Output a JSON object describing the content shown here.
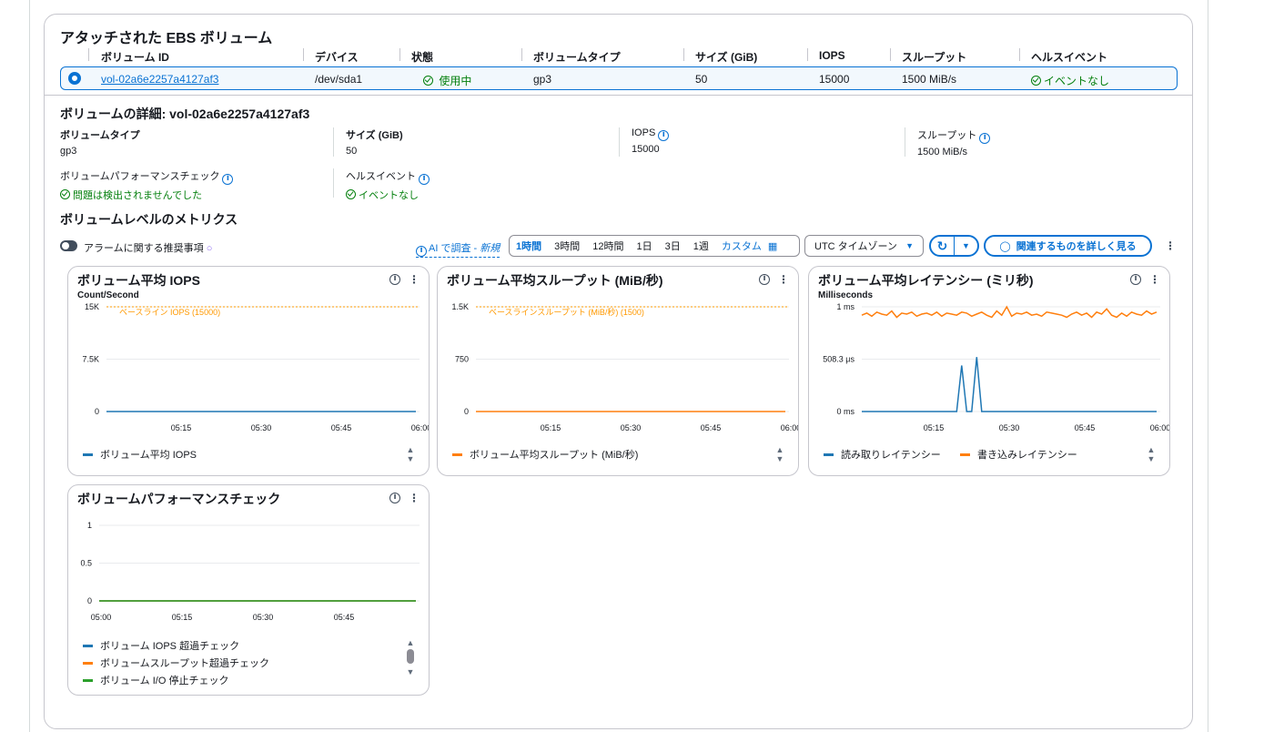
{
  "attached": {
    "title": "アタッチされた EBS ボリューム",
    "columns": [
      "ボリューム ID",
      "デバイス",
      "状態",
      "ボリュームタイプ",
      "サイズ (GiB)",
      "IOPS",
      "スループット",
      "ヘルスイベント"
    ],
    "row": {
      "volume_id": "vol-02a6e2257a4127af3",
      "device": "/dev/sda1",
      "state": "使用中",
      "type": "gp3",
      "size": "50",
      "iops": "15000",
      "throughput": "1500 MiB/s",
      "health": "イベントなし"
    }
  },
  "details": {
    "title": "ボリュームの詳細: vol-02a6e2257a4127af3",
    "type_label": "ボリュームタイプ",
    "type_value": "gp3",
    "size_label": "サイズ (GiB)",
    "size_value": "50",
    "iops_label": "IOPS",
    "iops_value": "15000",
    "throughput_label": "スループット",
    "throughput_value": "1500 MiB/s",
    "perf_label": "ボリュームパフォーマンスチェック",
    "perf_value": "問題は検出されませんでした",
    "health_label": "ヘルスイベント",
    "health_value": "イベントなし"
  },
  "metrics": {
    "title": "ボリュームレベルのメトリクス",
    "alarm_toggle": "アラームに関する推奨事項",
    "ai_label": "AI で調査 - ",
    "ai_new": "新規",
    "ranges": [
      "1時間",
      "3時間",
      "12時間",
      "1日",
      "3日",
      "1週",
      "カスタム"
    ],
    "active_range": "1時間",
    "timezone": "UTC タイムゾーン",
    "explore_button": "関連するものを詳しく見る"
  },
  "chart_data": [
    {
      "type": "line",
      "title": "ボリューム平均 IOPS",
      "ylabel": "Count/Second",
      "yticks": [
        "15K",
        "7.5K",
        "0"
      ],
      "ylim": [
        0,
        15000
      ],
      "x": [
        "05:15",
        "05:30",
        "05:45",
        "06:00"
      ],
      "series": [
        {
          "name": "ボリューム平均 IOPS",
          "values": [
            0,
            0,
            0,
            0,
            0
          ],
          "color": "#1f77b4"
        }
      ],
      "baseline": {
        "label": "ベースライン IOPS (15000)",
        "value": 15000,
        "color": "#ff9900"
      }
    },
    {
      "type": "line",
      "title": "ボリューム平均スループット (MiB/秒)",
      "ylabel": "",
      "yticks": [
        "1.5K",
        "750",
        "0"
      ],
      "ylim": [
        0,
        1500
      ],
      "x": [
        "05:15",
        "05:30",
        "05:45",
        "06:00"
      ],
      "series": [
        {
          "name": "ボリューム平均スループット (MiB/秒)",
          "values": [
            0,
            0,
            0,
            0,
            0
          ],
          "color": "#ff7f0e"
        }
      ],
      "baseline": {
        "label": "ベースラインスループット (MiB/秒) (1500)",
        "value": 1500,
        "color": "#ff9900"
      }
    },
    {
      "type": "line",
      "title": "ボリューム平均レイテンシー (ミリ秒)",
      "ylabel": "Milliseconds",
      "yticks": [
        "1 ms",
        "508.3 μs",
        "0 ms"
      ],
      "ylim": [
        0,
        1
      ],
      "x": [
        "05:15",
        "05:30",
        "05:45",
        "06:00"
      ],
      "series": [
        {
          "name": "読み取りレイテンシー",
          "color": "#1f77b4",
          "values": [
            0,
            0,
            0,
            0,
            0,
            0,
            0,
            0,
            0,
            0,
            0,
            0,
            0,
            0,
            0,
            0,
            0,
            0,
            0,
            0,
            0.44,
            0,
            0,
            0.52,
            0,
            0,
            0,
            0,
            0,
            0,
            0,
            0,
            0,
            0,
            0,
            0,
            0,
            0,
            0,
            0,
            0,
            0,
            0,
            0,
            0,
            0,
            0,
            0,
            0,
            0,
            0,
            0,
            0,
            0,
            0,
            0,
            0,
            0,
            0,
            0
          ]
        },
        {
          "name": "書き込みレイテンシー",
          "color": "#ff7f0e",
          "values": [
            0.92,
            0.94,
            0.91,
            0.95,
            0.93,
            0.92,
            0.96,
            0.9,
            0.94,
            0.93,
            0.95,
            0.91,
            0.93,
            0.94,
            0.92,
            0.95,
            0.91,
            0.94,
            0.93,
            0.92,
            0.95,
            0.94,
            0.91,
            0.93,
            0.95,
            0.92,
            0.9,
            0.96,
            0.92,
            1.0,
            0.91,
            0.94,
            0.93,
            0.95,
            0.92,
            0.93,
            0.91,
            0.95,
            0.94,
            0.93,
            0.92,
            0.9,
            0.93,
            0.95,
            0.92,
            0.94,
            0.9,
            0.95,
            0.93,
            0.98,
            0.92,
            0.9,
            0.94,
            0.91,
            0.95,
            0.93,
            0.92,
            0.96,
            0.93,
            0.95
          ]
        }
      ]
    },
    {
      "type": "line",
      "title": "ボリュームパフォーマンスチェック",
      "ylabel": "",
      "yticks": [
        "1",
        "0.5",
        "0"
      ],
      "ylim": [
        0,
        1
      ],
      "x": [
        "05:00",
        "05:15",
        "05:30",
        "05:45"
      ],
      "series": [
        {
          "name": "ボリューム IOPS 超過チェック",
          "values": [
            0,
            0,
            0,
            0,
            0
          ],
          "color": "#1f77b4"
        },
        {
          "name": "ボリュームスループット超過チェック",
          "values": [
            0,
            0,
            0,
            0,
            0
          ],
          "color": "#ff7f0e"
        },
        {
          "name": "ボリューム I/O 停止チェック",
          "values": [
            0,
            0,
            0,
            0,
            0
          ],
          "color": "#2ca02c"
        }
      ]
    }
  ]
}
